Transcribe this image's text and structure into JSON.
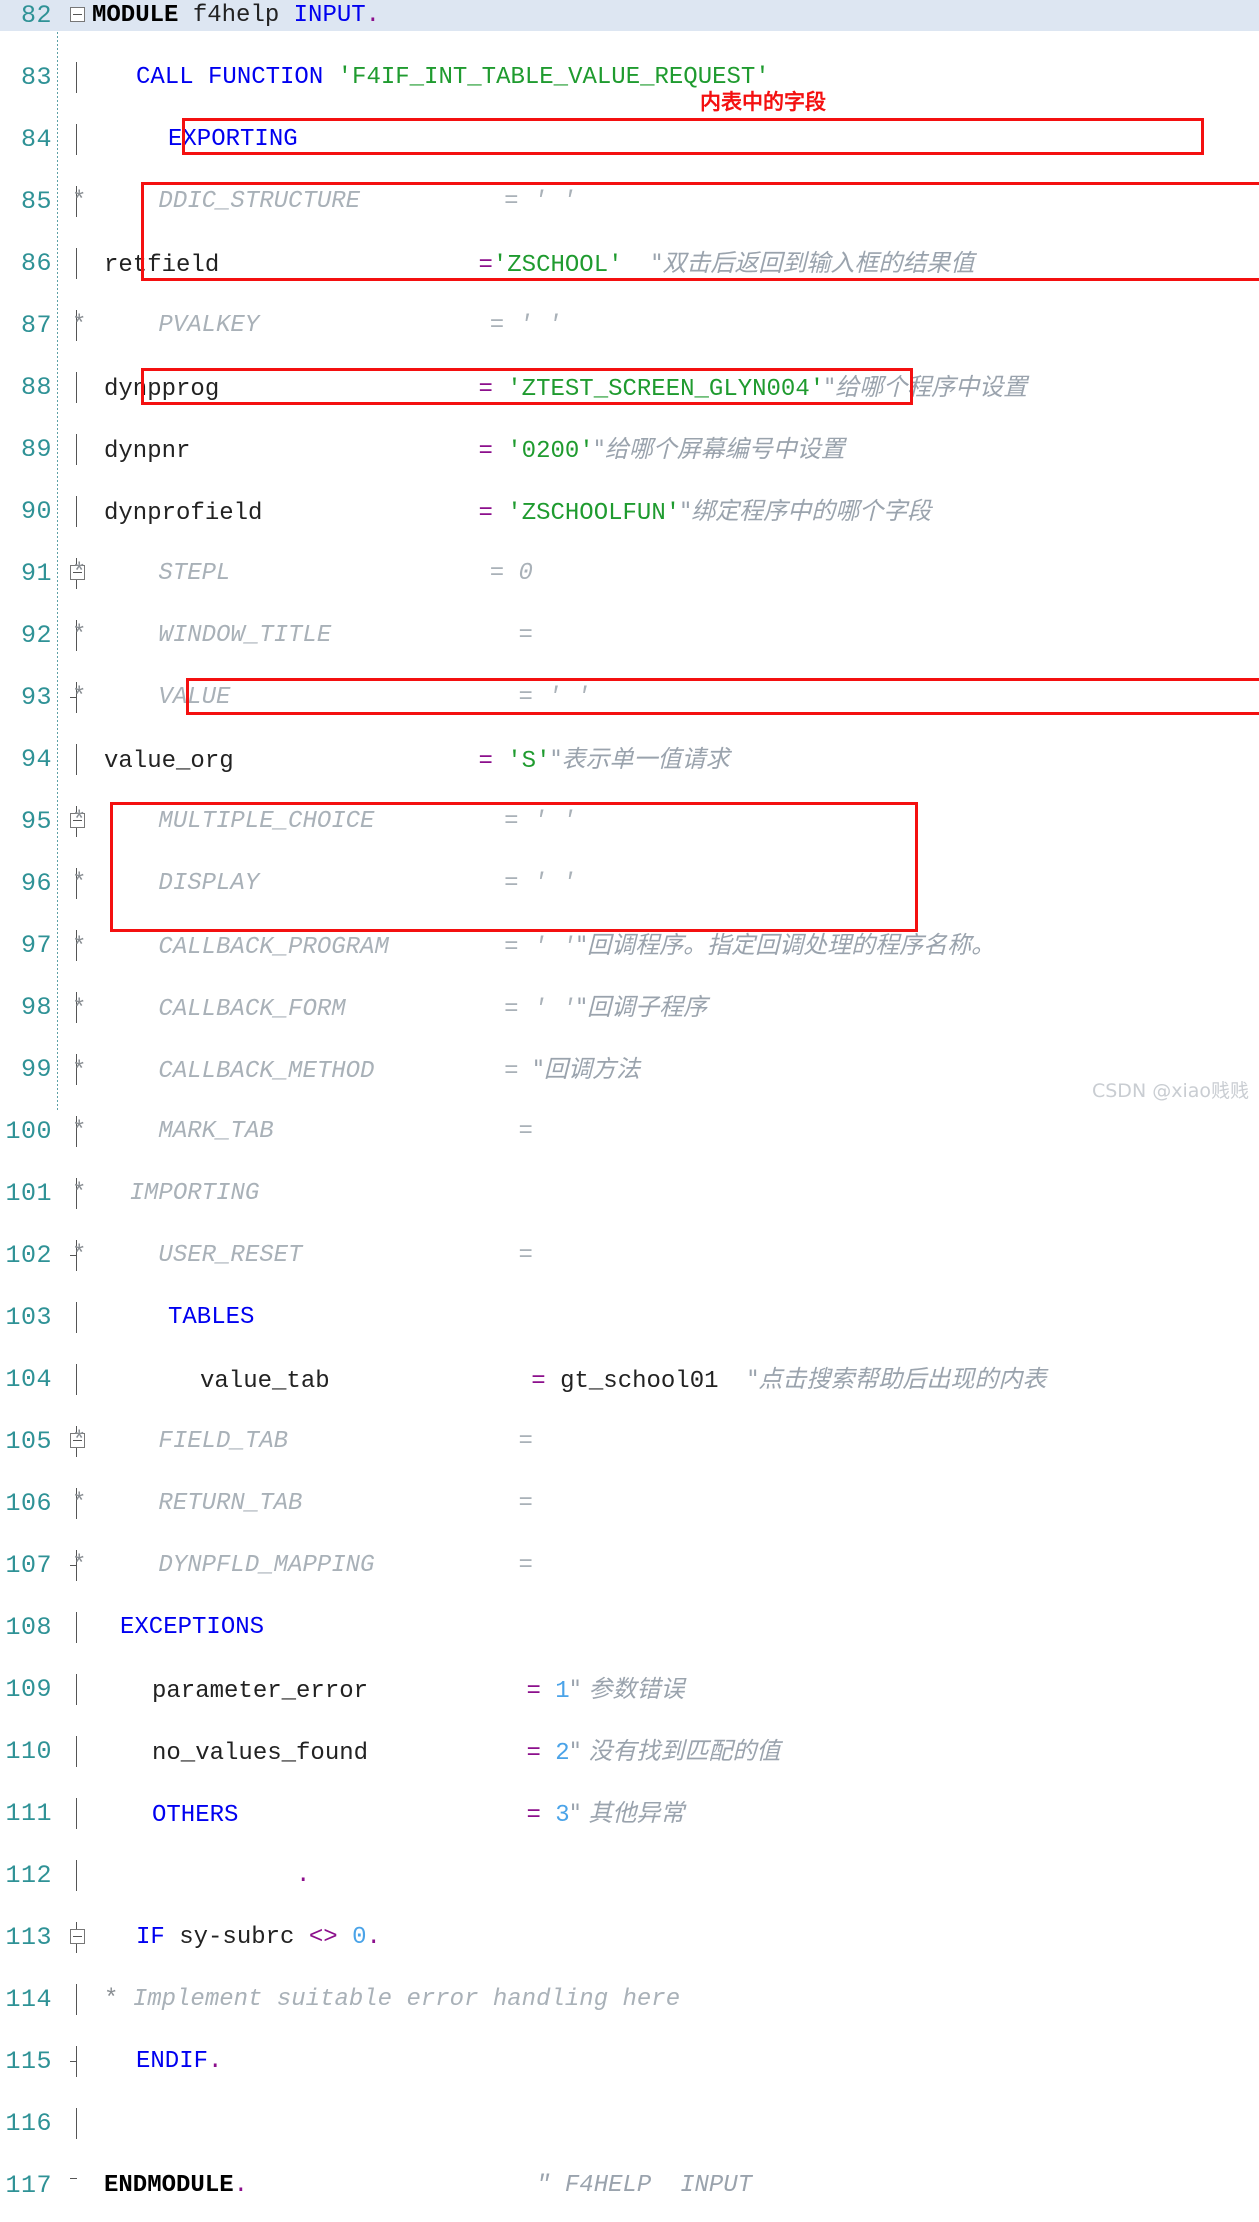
{
  "editor": {
    "language": "ABAP",
    "current_line": 82,
    "first_line": 82,
    "last_line": 117,
    "colors": {
      "keyword": "#0000f0",
      "string": "#1f9b2f",
      "operator": "#8c0f8c",
      "number": "#4aa3e8",
      "comment": "#9aa3ad",
      "linenumber": "#2f9296",
      "current_line_bg": "#dde6f2",
      "annotation_red": "#f41010",
      "watermark": "#c9cdd2"
    }
  },
  "lines": [
    {
      "no": "82",
      "text": "MODULE f4help INPUT."
    },
    {
      "no": "83",
      "text": "CALL FUNCTION 'F4IF_INT_TABLE_VALUE_REQUEST'"
    },
    {
      "no": "84",
      "text": "EXPORTING"
    },
    {
      "no": "85",
      "text": "*    DDIC_STRUCTURE            = ' '"
    },
    {
      "no": "86",
      "text": "retfield                  ='ZSCHOOL'  \"双击后返回到输入框的结果值"
    },
    {
      "no": "87",
      "text": "*    PVALKEY                  = ' '"
    },
    {
      "no": "88",
      "text": "dynpprog                  = 'ZTEST_SCREEN_GLYN004'\"给哪个程序中设置"
    },
    {
      "no": "89",
      "text": "dynpnr                    = '0200'\"给哪个屏幕编号中设置"
    },
    {
      "no": "90",
      "text": "dynprofield               = 'ZSCHOOLFUN'\"绑定程序中的哪个字段"
    },
    {
      "no": "91",
      "text": "*    STEPL                    = 0"
    },
    {
      "no": "92",
      "text": "*    WINDOW_TITLE             ="
    },
    {
      "no": "93",
      "text": "*    VALUE                    = ' '"
    },
    {
      "no": "94",
      "text": "value_org                 = 'S'\"表示单一值请求"
    },
    {
      "no": "95",
      "text": "*    MULTIPLE_CHOICE          = ' '"
    },
    {
      "no": "96",
      "text": "*    DISPLAY                  = ' '"
    },
    {
      "no": "97",
      "text": "*    CALLBACK_PROGRAM         = ' '\"回调程序。指定回调处理的程序名称。"
    },
    {
      "no": "98",
      "text": "*    CALLBACK_FORM            = ' '\"回调子程序"
    },
    {
      "no": "99",
      "text": "*    CALLBACK_METHOD          = \"回调方法"
    },
    {
      "no": "100",
      "text": "*    MARK_TAB                 ="
    },
    {
      "no": "101",
      "text": "*  IMPORTING"
    },
    {
      "no": "102",
      "text": "*    USER_RESET               ="
    },
    {
      "no": "103",
      "text": "TABLES"
    },
    {
      "no": "104",
      "text": "value_tab                 = gt_school01  \"点击搜索帮助后出现的内表"
    },
    {
      "no": "105",
      "text": "*    FIELD_TAB                ="
    },
    {
      "no": "106",
      "text": "*    RETURN_TAB               ="
    },
    {
      "no": "107",
      "text": "*    DYNPFLD_MAPPING          ="
    },
    {
      "no": "108",
      "text": "EXCEPTIONS"
    },
    {
      "no": "109",
      "text": "parameter_error           = 1\" 参数错误"
    },
    {
      "no": "110",
      "text": "no_values_found           = 2\" 没有找到匹配的值"
    },
    {
      "no": "111",
      "text": "OTHERS                    = 3\" 其他异常"
    },
    {
      "no": "112",
      "text": "        ."
    },
    {
      "no": "113",
      "text": "IF sy-subrc <> 0."
    },
    {
      "no": "114",
      "text": "* Implement suitable error handling here"
    },
    {
      "no": "115",
      "text": "ENDIF."
    },
    {
      "no": "116",
      "text": ""
    },
    {
      "no": "117",
      "text": "ENDMODULE.                    \" F4HELP  INPUT"
    }
  ],
  "tokens": {
    "l82": {
      "kw_module": "MODULE",
      "name": "f4help",
      "kw_input": "INPUT",
      "dot": "."
    },
    "l83": {
      "kw_call": "CALL",
      "kw_function": "FUNCTION",
      "fname": "'F4IF_INT_TABLE_VALUE_REQUEST'"
    },
    "l84": {
      "kw": "EXPORTING"
    },
    "l85": {
      "star": "*",
      "param": "DDIC_STRUCTURE",
      "eq": "=",
      "val": "' '"
    },
    "l86": {
      "param": "retfield",
      "eq": "=",
      "val": "'ZSCHOOL'",
      "cmt": "\"双击后返回到输入框的结果值"
    },
    "l87": {
      "star": "*",
      "param": "PVALKEY",
      "eq": "=",
      "val": "' '"
    },
    "l88": {
      "param": "dynpprog",
      "eq": "=",
      "val": "'ZTEST_SCREEN_GLYN004'",
      "cmt": "\"给哪个程序中设置"
    },
    "l89": {
      "param": "dynpnr",
      "eq": "=",
      "val": "'0200'",
      "cmt": "\"给哪个屏幕编号中设置"
    },
    "l90": {
      "param": "dynprofield",
      "eq": "=",
      "val": "'ZSCHOOLFUN'",
      "cmt": "\"绑定程序中的哪个字段"
    },
    "l91": {
      "star": "*",
      "param": "STEPL",
      "eq": "=",
      "val": "0"
    },
    "l92": {
      "star": "*",
      "param": "WINDOW_TITLE",
      "eq": "="
    },
    "l93": {
      "star": "*",
      "param": "VALUE",
      "eq": "=",
      "val": "' '"
    },
    "l94": {
      "param": "value_org",
      "eq": "=",
      "val": "'S'",
      "cmt": "\"表示单一值请求"
    },
    "l95": {
      "star": "*",
      "param": "MULTIPLE_CHOICE",
      "eq": "=",
      "val": "' '"
    },
    "l96": {
      "star": "*",
      "param": "DISPLAY",
      "eq": "=",
      "val": "' '"
    },
    "l97": {
      "star": "*",
      "param": "CALLBACK_PROGRAM",
      "eq": "=",
      "val": "' '",
      "cmt": "\"回调程序。指定回调处理的程序名称。"
    },
    "l98": {
      "star": "*",
      "param": "CALLBACK_FORM",
      "eq": "=",
      "val": "' '",
      "cmt": "\"回调子程序"
    },
    "l99": {
      "star": "*",
      "param": "CALLBACK_METHOD",
      "eq": "=",
      "cmt": "\"回调方法"
    },
    "l100": {
      "star": "*",
      "param": "MARK_TAB",
      "eq": "="
    },
    "l101": {
      "star": "*",
      "kw": "IMPORTING"
    },
    "l102": {
      "star": "*",
      "param": "USER_RESET",
      "eq": "="
    },
    "l103": {
      "kw": "TABLES"
    },
    "l104": {
      "param": "value_tab",
      "eq": "=",
      "val": "gt_school01",
      "cmt": "\"点击搜索帮助后出现的内表"
    },
    "l105": {
      "star": "*",
      "param": "FIELD_TAB",
      "eq": "="
    },
    "l106": {
      "star": "*",
      "param": "RETURN_TAB",
      "eq": "="
    },
    "l107": {
      "star": "*",
      "param": "DYNPFLD_MAPPING",
      "eq": "="
    },
    "l108": {
      "kw": "EXCEPTIONS"
    },
    "l109": {
      "param": "parameter_error",
      "eq": "=",
      "num": "1",
      "cmt": "\" 参数错误"
    },
    "l110": {
      "param": "no_values_found",
      "eq": "=",
      "num": "2",
      "cmt": "\" 没有找到匹配的值"
    },
    "l111": {
      "param": "OTHERS",
      "eq": "=",
      "num": "3",
      "cmt": "\" 其他异常"
    },
    "l112": {
      "dot": "."
    },
    "l113": {
      "kw_if": "IF",
      "var": "sy-subrc",
      "op": "<>",
      "num": "0",
      "dot": "."
    },
    "l114": {
      "star": "*",
      "cmt": "Implement suitable error handling here"
    },
    "l115": {
      "kw": "ENDIF",
      "dot": "."
    },
    "l117": {
      "kw": "ENDMODULE",
      "dot": ".",
      "cmt": "\" F4HELP  INPUT"
    }
  },
  "annotations": {
    "note_inner_table_field": "内表中的字段",
    "boxes": [
      {
        "id": "box-retfield",
        "lines": "86"
      },
      {
        "id": "box-dynp",
        "lines": "88-90"
      },
      {
        "id": "box-value-org",
        "lines": "94"
      },
      {
        "id": "box-value-tab",
        "lines": "104"
      },
      {
        "id": "box-exceptions",
        "lines": "108-111"
      }
    ]
  },
  "watermark": {
    "text": "CSDN @xiao贱贱"
  }
}
